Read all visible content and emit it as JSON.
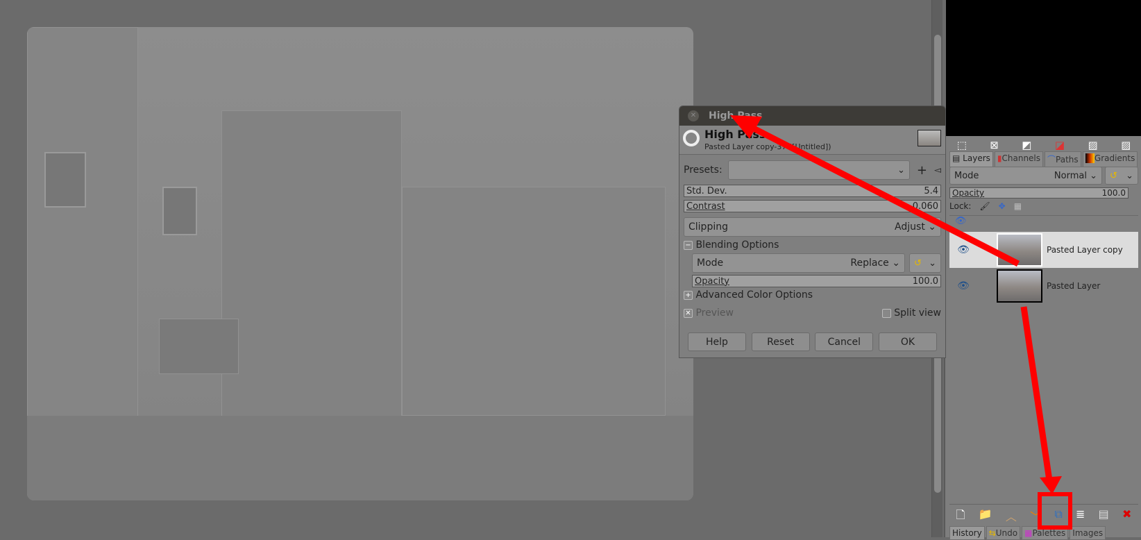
{
  "dialog": {
    "window_title": "High Pass",
    "header_title": "High Pass",
    "header_subtitle": "Pasted Layer copy-37 ([Untitled])",
    "presets_label": "Presets:",
    "presets_value": "",
    "std_dev_label": "Std. Dev.",
    "std_dev_value": "5.4",
    "contrast_label": "Contrast",
    "contrast_value": "0.060",
    "clipping_label": "Clipping",
    "clipping_value": "Adjust",
    "blending_label": "Blending Options",
    "mode_label": "Mode",
    "mode_value": "Replace",
    "opacity_label": "Opacity",
    "opacity_value": "100.0",
    "advanced_label": "Advanced Color Options",
    "preview_label": "Preview",
    "preview_checked": true,
    "split_view_label": "Split view",
    "split_view_checked": false,
    "buttons": {
      "help": "Help",
      "reset": "Reset",
      "cancel": "Cancel",
      "ok": "OK"
    }
  },
  "layers_panel": {
    "tabs": [
      "Layers",
      "Channels",
      "Paths",
      "Gradients"
    ],
    "mode_label": "Mode",
    "mode_value": "Normal",
    "opacity_label": "Opacity",
    "opacity_value": "100.0",
    "lock_label": "Lock:",
    "layers": [
      {
        "name": "Pasted Layer copy",
        "visible": true,
        "selected": true
      },
      {
        "name": "Pasted Layer",
        "visible": true,
        "selected": false
      }
    ],
    "bottom_tabs": [
      "History",
      "Undo",
      "Palettes",
      "Images"
    ]
  },
  "annotation_color": "#ff0000"
}
